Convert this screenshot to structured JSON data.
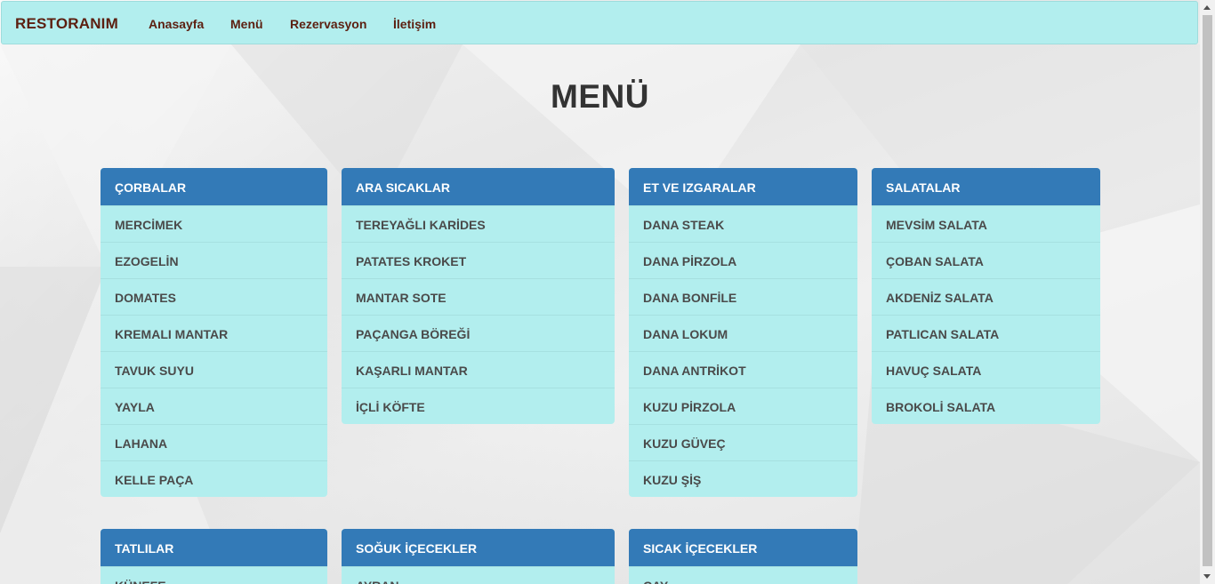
{
  "navbar": {
    "brand": "RESTORANIM",
    "links": [
      "Anasayfa",
      "Menü",
      "Rezervasyon",
      "İletişim"
    ]
  },
  "page_title": "MENÜ",
  "panels": [
    {
      "title": "ÇORBALAR",
      "items": [
        "MERCİMEK",
        "EZOGELİN",
        "DOMATES",
        "KREMALI MANTAR",
        "TAVUK SUYU",
        "YAYLA",
        "LAHANA",
        "KELLE PAÇA"
      ]
    },
    {
      "title": "ARA SICAKLAR",
      "items": [
        "TEREYAĞLI KARİDES",
        "PATATES KROKET",
        "MANTAR SOTE",
        "PAÇANGA BÖREĞİ",
        "KAŞARLI MANTAR",
        "İÇLİ KÖFTE"
      ]
    },
    {
      "title": "ET VE IZGARALAR",
      "items": [
        "DANA STEAK",
        "DANA PİRZOLA",
        "DANA BONFİLE",
        "DANA LOKUM",
        "DANA ANTRİKOT",
        "KUZU PİRZOLA",
        "KUZU GÜVEÇ",
        "KUZU ŞİŞ"
      ]
    },
    {
      "title": "SALATALAR",
      "items": [
        "MEVSİM SALATA",
        "ÇOBAN SALATA",
        "AKDENİZ SALATA",
        "PATLICAN SALATA",
        "HAVUÇ SALATA",
        "BROKOLİ SALATA"
      ]
    },
    {
      "title": "TATLILAR",
      "items": [
        "KÜNEFE"
      ]
    },
    {
      "title": "SOĞUK İÇECEKLER",
      "items": [
        "AYRAN"
      ]
    },
    {
      "title": "SICAK İÇECEKLER",
      "items": [
        "ÇAY"
      ]
    }
  ],
  "colors": {
    "navbar_bg": "#b2eeee",
    "panel_header": "#337ab7",
    "panel_body": "#b2eeee",
    "brand_text": "#5c1f10"
  }
}
